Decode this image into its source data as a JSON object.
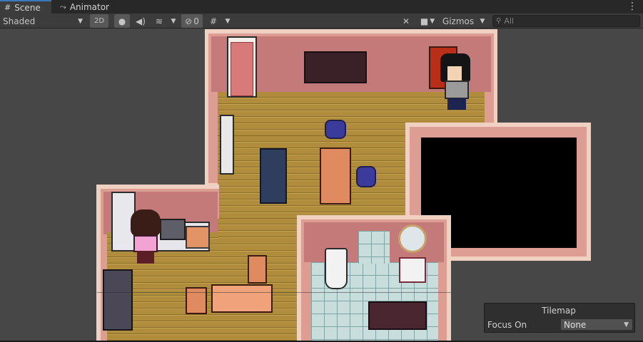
{
  "tabs": [
    {
      "label": "Scene",
      "icon": "grid-icon",
      "active": true
    },
    {
      "label": "Animator",
      "icon": "animator-icon",
      "active": false
    }
  ],
  "toolbar": {
    "shading_mode": "Shaded",
    "mode_2d_label": "2D",
    "hidden_count": "0",
    "gizmos_label": "Gizmos",
    "search_placeholder": "All"
  },
  "tilemap_overlay": {
    "title": "Tilemap",
    "focus_label": "Focus On",
    "focus_value": "None"
  },
  "colors": {
    "wall_pink": "#c57a7a",
    "wall_trim": "#f0d0c0",
    "floor_wood": "#b08d3c",
    "tile_floor": "#c8dedd",
    "accent_tab": "#3a79bb"
  }
}
